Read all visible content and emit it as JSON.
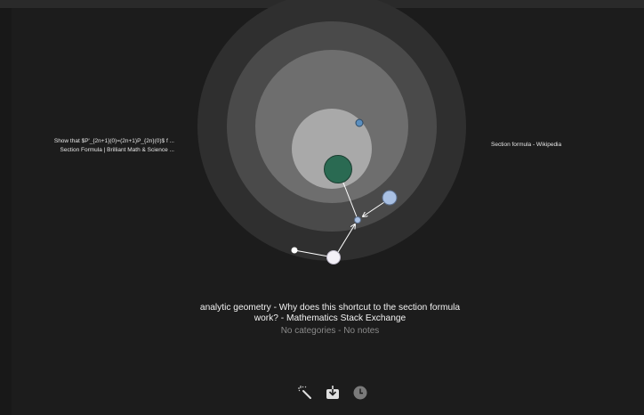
{
  "left_labels": [
    "Show that $P'_{2n+1}(0)=(2n+1)P_{2n}(0)$ f ...",
    "Section Formula | Brilliant Math & Science ..."
  ],
  "right_labels": [
    "Section formula - Wikipedia"
  ],
  "title": "analytic geometry - Why does this shortcut to the section formula work? - Mathematics Stack Exchange",
  "subtitle": "No categories - No notes",
  "toolbar": {
    "icons": [
      "magic-wand-icon",
      "download-icon",
      "clock-icon"
    ]
  },
  "colors": {
    "ring_outer": "#2f2f2f",
    "ring_2": "#4a4a4a",
    "ring_3": "#6e6e6e",
    "ring_4": "#8c8c8c",
    "ring_inner": "#a9a9a9",
    "center_node": "#2a6a52",
    "blue_node": "#5b8fbf",
    "light_blue_node": "#a9c0e3"
  }
}
